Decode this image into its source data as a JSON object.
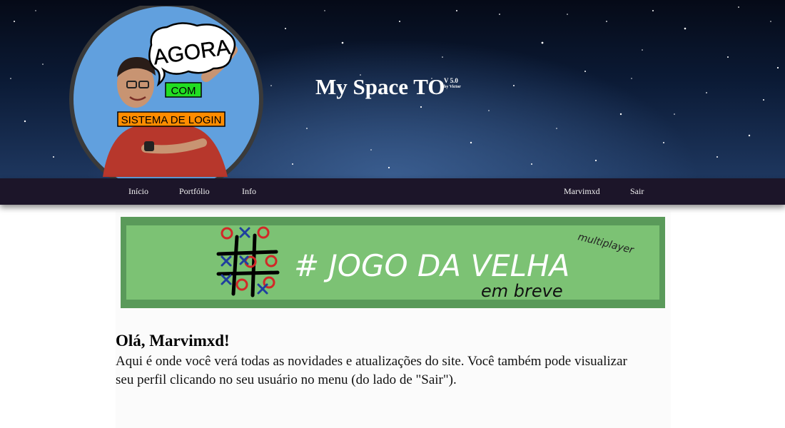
{
  "header": {
    "logo": {
      "headline": "AGORA",
      "connector": "COM",
      "tagline": "SISTEMA DE LOGIN"
    },
    "site_title": "My Space TO",
    "version": "V 5.0",
    "author": "by Victor"
  },
  "nav": {
    "left": [
      "Início",
      "Portfólio",
      "Info"
    ],
    "right": [
      "Marvimxd",
      "Sair"
    ]
  },
  "banner": {
    "title": "# JOGO DA VELHA",
    "subtitle": "em breve",
    "tag": "multiplayer",
    "colors": {
      "frame": "#5a9a5a",
      "fill": "#7cc274",
      "text": "#ffffff",
      "x_mark": "#1f3f9e",
      "o_mark": "#d22828"
    }
  },
  "main": {
    "greeting": "Olá, Marvimxd!",
    "intro": "Aqui é onde você verá todas as novidades e atualizações do site. Você também pode visualizar seu perfil clicando no seu usuário no menu (do lado de \"Sair\")."
  }
}
